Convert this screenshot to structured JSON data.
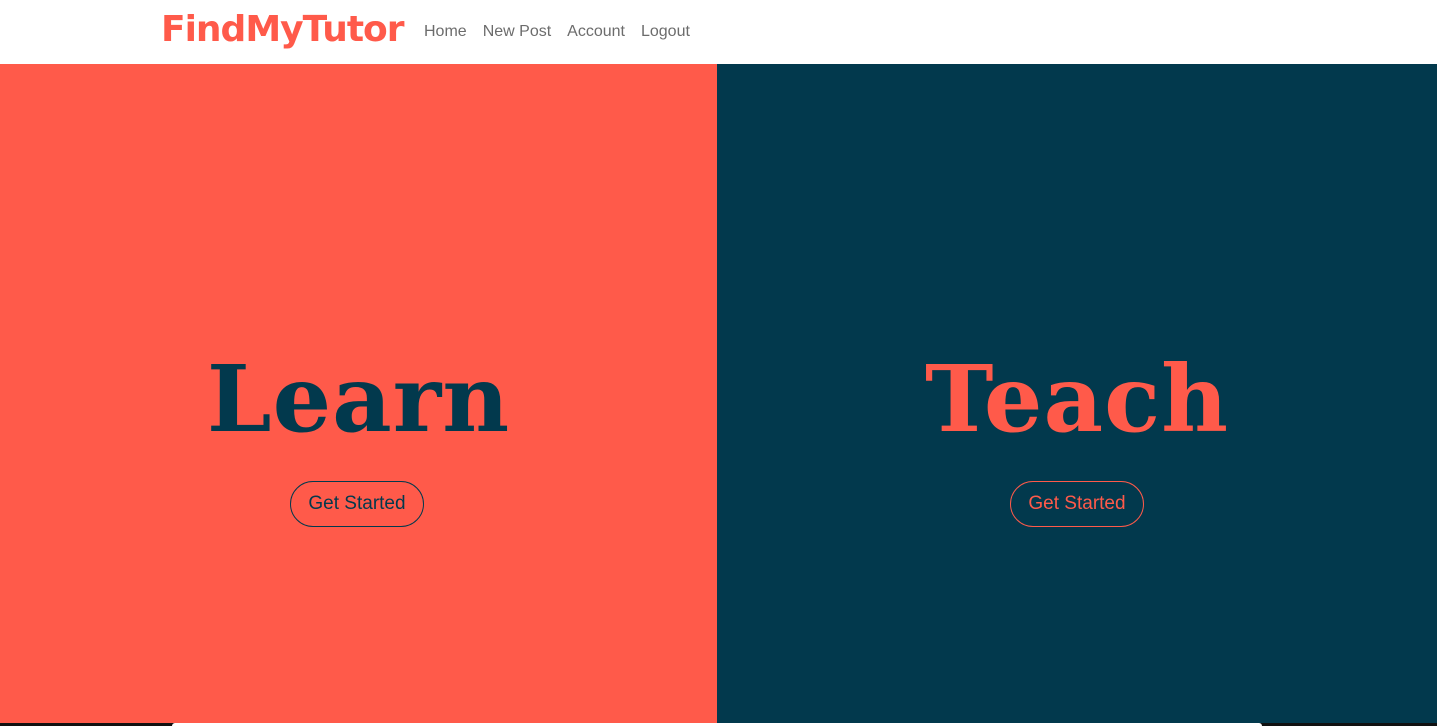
{
  "navbar": {
    "brand": "FindMyTutor",
    "links": [
      {
        "label": "Home"
      },
      {
        "label": "New Post"
      },
      {
        "label": "Account"
      },
      {
        "label": "Logout"
      }
    ]
  },
  "panels": {
    "learn": {
      "heading": "Learn",
      "button_label": "Get Started"
    },
    "teach": {
      "heading": "Teach",
      "button_label": "Get Started"
    }
  },
  "colors": {
    "coral": "#ff5a4a",
    "navy": "#02394d",
    "nav_text": "#6c6c6c"
  }
}
